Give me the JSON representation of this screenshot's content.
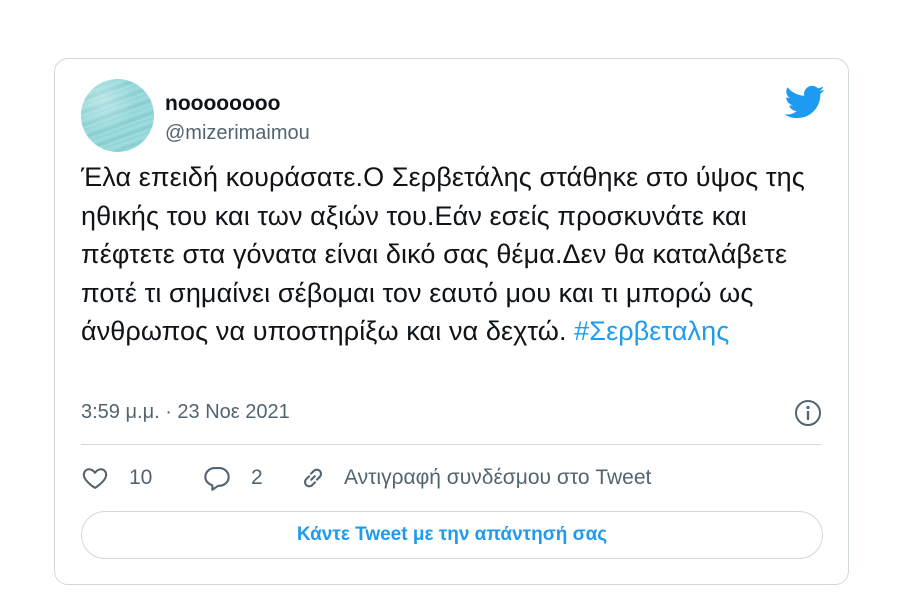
{
  "tweet": {
    "author": {
      "display_name": "noooooooo",
      "handle": "@mizerimaimou",
      "avatar_icon": "avatar-image"
    },
    "brand_icon": "twitter-bird-icon",
    "brand_color": "#1d9bf0",
    "text": "Έλα επειδή κουράσατε.Ο Σερβετάλης στάθηκε στο ύψος της ηθικής του και των αξιών του.Εάν εσείς προσκυνάτε και πέφτετε στα γόνατα είναι δικό σας θέμα.Δεν θα καταλάβετε ποτέ τι σημαίνει σέβομαι τον εαυτό μου και τι μπορώ ως άνθρωπος να υποστηρίξω και να δεχτώ. ",
    "hashtag": "#Σερβεταλης",
    "timestamp": "3:59 μ.μ. · 23 Νοε 2021",
    "info_icon": "info-icon",
    "actions": {
      "like_icon": "heart-icon",
      "like_count": "10",
      "reply_icon": "comment-icon",
      "reply_count": "2",
      "copy_link_icon": "link-icon",
      "copy_link_label": "Αντιγραφή συνδέσμου στο Tweet"
    },
    "reply_button_label": "Κάντε Tweet με την απάντησή σας"
  }
}
